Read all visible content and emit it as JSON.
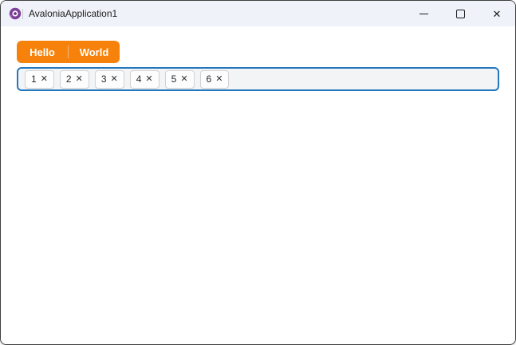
{
  "window": {
    "title": "AvaloniaApplication1",
    "controls": {
      "close_glyph": "✕"
    }
  },
  "tab_bar": {
    "tabs": [
      {
        "label": "Hello"
      },
      {
        "label": "World"
      }
    ]
  },
  "chip_input": {
    "chips": [
      {
        "label": "1"
      },
      {
        "label": "2"
      },
      {
        "label": "3"
      },
      {
        "label": "4"
      },
      {
        "label": "5"
      },
      {
        "label": "6"
      }
    ],
    "remove_glyph": "✕"
  },
  "colors": {
    "accent_orange": "#f6820c",
    "focus_border_blue": "#2277bd",
    "titlebar_bg": "#eff3f9",
    "logo_purple": "#7d3f98"
  }
}
